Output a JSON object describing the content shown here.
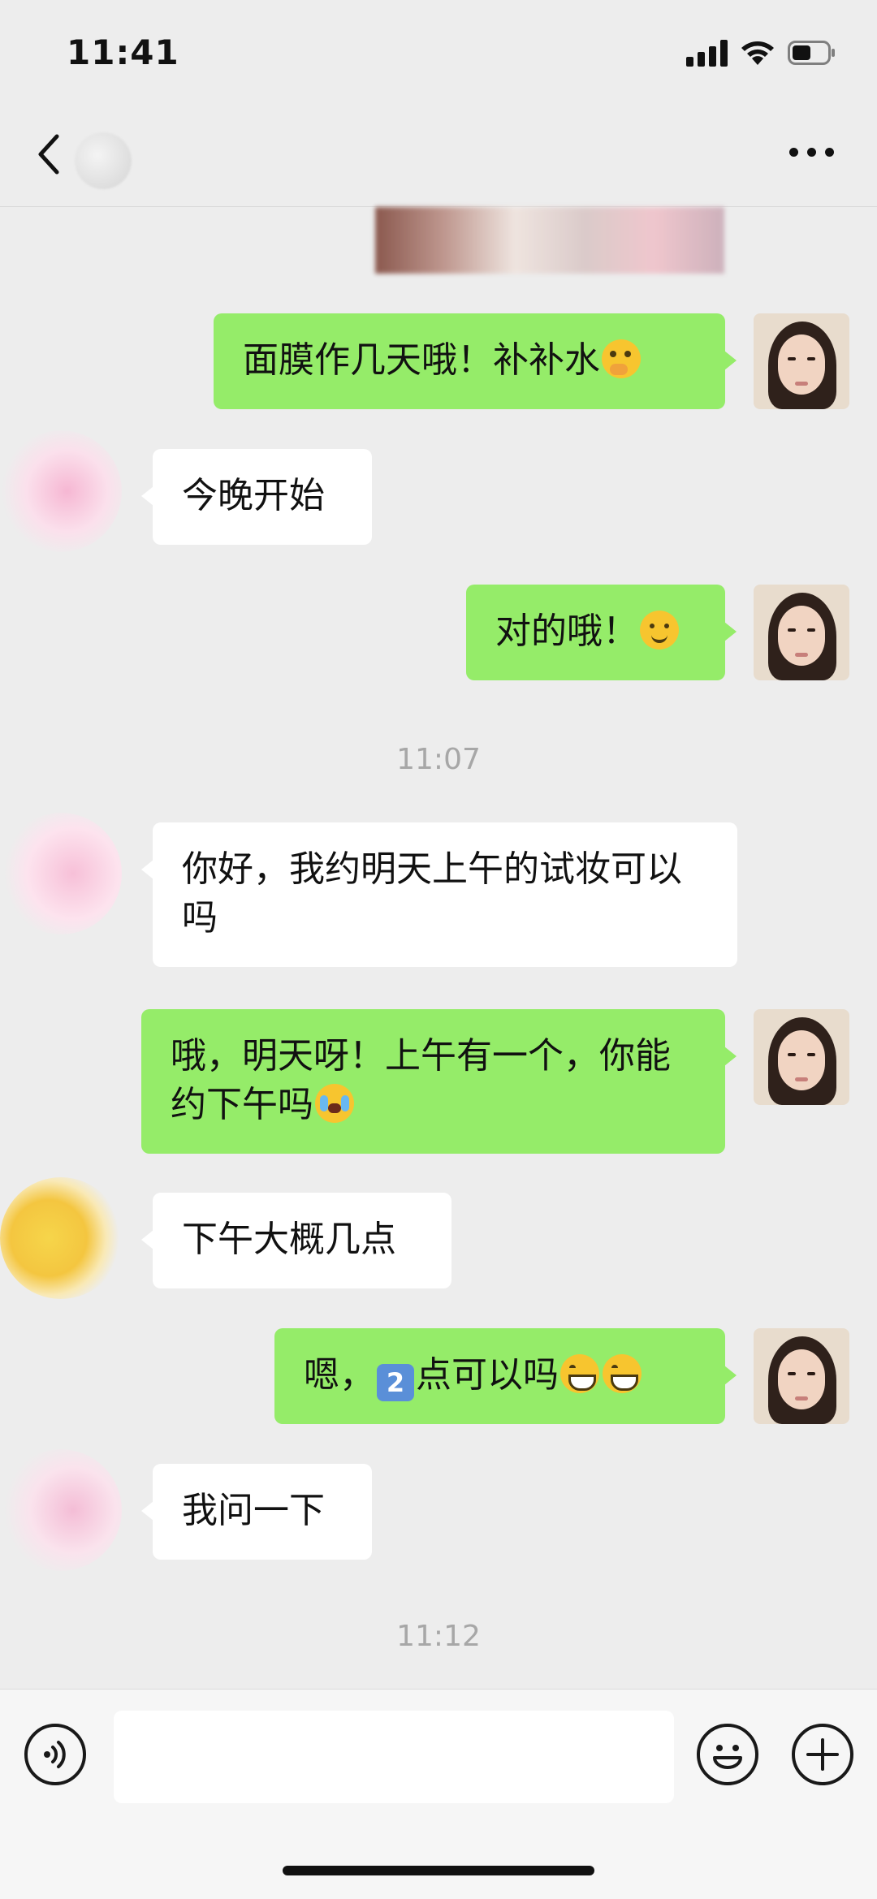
{
  "status_bar": {
    "time": "11:41"
  },
  "header": {
    "title": "",
    "more_label": "···"
  },
  "messages": [
    {
      "from": "me",
      "text": "面膜作几天哦！补补水",
      "emoji": "thinking-emoji"
    },
    {
      "from": "other",
      "text": "今晚开始"
    },
    {
      "from": "me",
      "text": "对的哦！",
      "emoji": "smile-emoji"
    },
    {
      "type": "timestamp",
      "text": "11:07"
    },
    {
      "from": "other",
      "text": "你好，我约明天上午的试妆可以吗"
    },
    {
      "from": "me",
      "text": "哦，明天呀！上午有一个，你能约下午吗",
      "emoji": "crying-laughing-emoji"
    },
    {
      "from": "other",
      "text": "下午大概几点"
    },
    {
      "from": "me",
      "text_before": "嗯，",
      "keycap": "2",
      "text_after": "点可以吗",
      "emoji": "grin-emoji"
    },
    {
      "from": "other",
      "text": "我问一下"
    },
    {
      "type": "timestamp",
      "text": "11:12"
    }
  ],
  "input_bar": {
    "placeholder": ""
  },
  "icons": {
    "back": "chevron-left-icon",
    "more": "more-icon",
    "voice": "voice-icon",
    "emoji": "emoji-icon",
    "plus": "plus-icon"
  },
  "colors": {
    "my_bubble": "#95ec69",
    "other_bubble": "#ffffff",
    "background": "#ededed"
  }
}
